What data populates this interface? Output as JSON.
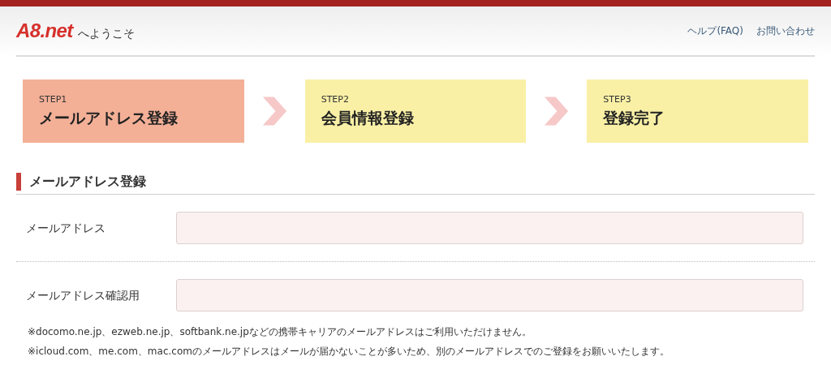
{
  "header": {
    "logo": "A8.net",
    "welcome": "へようこそ",
    "links": [
      "ヘルプ(FAQ)",
      "お問い合わせ"
    ]
  },
  "steps": [
    {
      "number": "STEP1",
      "label": "メールアドレス登録",
      "selected": true
    },
    {
      "number": "STEP2",
      "label": "会員情報登録",
      "selected": false
    },
    {
      "number": "STEP3",
      "label": "登録完了",
      "selected": false
    }
  ],
  "section": {
    "title": "メールアドレス登録"
  },
  "fields": [
    {
      "label": "メールアドレス"
    },
    {
      "label": "メールアドレス確認用"
    }
  ],
  "notes": [
    "※docomo.ne.jp、ezweb.ne.jp、softbank.ne.jpなどの携帯キャリアのメールアドレスはご利用いただけません。",
    "※icloud.com、me.com、mac.comのメールアドレスはメールが届かないことが多いため、別のメールアドレスでのご登録をお願いいたします。"
  ]
}
